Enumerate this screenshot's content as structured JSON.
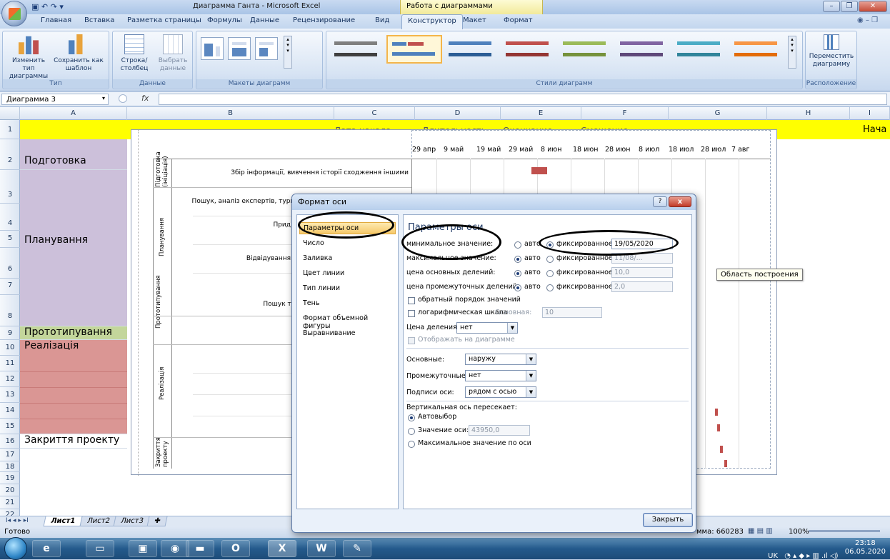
{
  "window": {
    "title": "Диаграмма Ганта - Microsoft Excel",
    "context_title": "Работа с диаграммами"
  },
  "ribbon_tabs": [
    "Главная",
    "Вставка",
    "Разметка страницы",
    "Формулы",
    "Данные",
    "Рецензирование",
    "Вид",
    "Конструктор",
    "Макет",
    "Формат"
  ],
  "active_tab": "Конструктор",
  "ribbon": {
    "type_group": {
      "label": "Тип",
      "btn1": "Изменить тип диаграммы",
      "btn2": "Сохранить как шаблон"
    },
    "data_group": {
      "label": "Данные",
      "btn1": "Строка/столбец",
      "btn2": "Выбрать данные"
    },
    "layouts_group": {
      "label": "Макеты диаграмм"
    },
    "styles_group": {
      "label": "Стили диаграмм"
    },
    "location_group": {
      "label": "Расположение",
      "btn1": "Переместить диаграмму"
    }
  },
  "name_box": "Диаграмма 3",
  "fx": "fx",
  "columns": [
    "A",
    "B",
    "C",
    "D",
    "E",
    "F",
    "G",
    "H",
    "I"
  ],
  "rows": [
    "1",
    "2",
    "3",
    "4",
    "5",
    "6",
    "7",
    "8",
    "9",
    "10",
    "11",
    "12",
    "13",
    "14",
    "15",
    "16",
    "17",
    "18",
    "19",
    "20",
    "21",
    "22"
  ],
  "column_header_texts": {
    "c": "Дата начала",
    "d": "Длительность",
    "e": "Окончание",
    "f": "Смещение",
    "i": "Нача"
  },
  "phases": {
    "row2": "Подготовка (ініціація)",
    "row5": "Планування",
    "row9": "Прототипування",
    "row10": "Реалізація",
    "row16": "Закриття проекту"
  },
  "chart": {
    "phase_labels": [
      "Підготовка (ініціація)",
      "Планування",
      "Прототипування",
      "Реалізація",
      "Закриття проекту"
    ],
    "task_labels": [
      "Збір інформації, вивчення історії сходження іншими",
      "Пошук, аналіз експертів, туристичної компанії (постачальника)",
      "Прид",
      "Відвідування клуб",
      "Пошук техні"
    ],
    "x_ticks": [
      "29 апр",
      "9 май",
      "19 май",
      "29 май",
      "8 июн",
      "18 июн",
      "28 июн",
      "8 июл",
      "18 июл",
      "28 июл",
      "7 авг"
    ]
  },
  "tooltip": "Область построения",
  "dialog": {
    "title": "Формат оси",
    "help": "?",
    "close_x": "x",
    "nav_items": [
      "Параметры оси",
      "Число",
      "Заливка",
      "Цвет линии",
      "Тип линии",
      "Тень",
      "Формат объемной фигуры",
      "Выравнивание"
    ],
    "panel_title": "Параметры оси",
    "min_label": "минимальное значение:",
    "max_label": "максимальное значение:",
    "major_label": "цена основных делений:",
    "minor_label": "цена промежуточных делений:",
    "auto": "авто",
    "fixed": "фиксированное",
    "min_value": "19/05/2020",
    "max_value": "11/08/...",
    "major_value": "10,0",
    "minor_value": "2,0",
    "reverse": "обратный порядок значений",
    "log": "логарифмическая шкала",
    "base_label": "Основная:",
    "base_value": "10",
    "unit_label": "Цена деления:",
    "unit_value": "нет",
    "show_units": "Отображать на диаграмме",
    "major_tick_label": "Основные:",
    "major_tick_value": "наружу",
    "minor_tick_label": "Промежуточные:",
    "minor_tick_value": "нет",
    "axis_labels_label": "Подписи оси:",
    "axis_labels_value": "рядом с осью",
    "crosses_label": "Вертикальная ось пересекает:",
    "crosses_auto": "Автовыбор",
    "crosses_value_label": "Значение оси:",
    "crosses_value": "43950,0",
    "crosses_max": "Максимальное значение по оси",
    "close_button": "Закрыть"
  },
  "sheet_tabs": [
    "Лист1",
    "Лист2",
    "Лист3"
  ],
  "status": {
    "ready": "Готово",
    "sum": "мма: 660283",
    "zoom": "100%"
  },
  "tray": {
    "lang": "UK",
    "time": "23:18",
    "date": "06.05.2020"
  }
}
